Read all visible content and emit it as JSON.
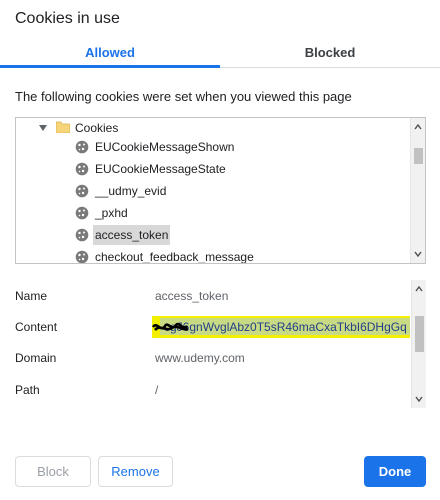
{
  "dialog": {
    "title": "Cookies in use"
  },
  "tabs": [
    {
      "label": "Allowed",
      "active": true
    },
    {
      "label": "Blocked",
      "active": false
    }
  ],
  "intro_text": "The following cookies were set when you viewed this page",
  "tree": {
    "folder_label": "Cookies",
    "items": [
      {
        "label": "EUCookieMessageShown"
      },
      {
        "label": "EUCookieMessageState"
      },
      {
        "label": "__udmy_evid"
      },
      {
        "label": "_pxhd"
      },
      {
        "label": "access_token",
        "selected": true
      },
      {
        "label": "checkout_feedback_message"
      }
    ]
  },
  "details": {
    "name": {
      "label": "Name",
      "value": "access_token"
    },
    "content": {
      "label": "Content",
      "value": "cgJ6gnWvglAbz0T5sR46maCxaTkbI6DHgGq"
    },
    "domain": {
      "label": "Domain",
      "value": "www.udemy.com"
    },
    "path": {
      "label": "Path",
      "value": "/"
    }
  },
  "buttons": {
    "block": "Block",
    "remove": "Remove",
    "done": "Done"
  },
  "colors": {
    "accent": "#1a73e8",
    "highlight": "#f2f000"
  }
}
